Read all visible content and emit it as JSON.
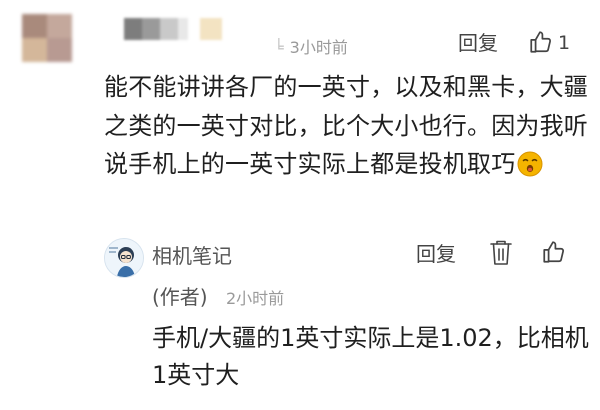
{
  "comment": {
    "time": "3小时前",
    "time_prefix_fragment": "╘",
    "reply_label": "回复",
    "like_count": "1",
    "text": "能不能讲讲各厂的一英寸，以及和黑卡，大疆之类的一英寸对比，比个大小也行。因为我听说手机上的一英寸实际上都是投机取巧",
    "emoji": "smirk-emoji",
    "icons": {
      "like": "thumbs-up-icon"
    },
    "avatar_blur_colors": [
      "#a98a7c",
      "#c4a89c",
      "#d4b79a",
      "#b89a92"
    ],
    "name_blur_colors": [
      "#7d7d7d",
      "#9a9a9a",
      "#c9c9c9",
      "#e8e8e8",
      "#f3e3c2"
    ]
  },
  "reply": {
    "author_name": "相机笔记",
    "author_tag": "(作者)",
    "time": "2小时前",
    "reply_label": "回复",
    "text": "手机/大疆的1英寸实际上是1.02，比相机1英寸大",
    "icons": {
      "avatar": "avatar-cartoon-icon",
      "delete": "trash-icon",
      "like": "thumbs-up-icon"
    }
  },
  "colors": {
    "text": "#1f1f1f",
    "meta": "#9a9a9a",
    "action": "#444444",
    "emoji_face": "#f5b400"
  }
}
